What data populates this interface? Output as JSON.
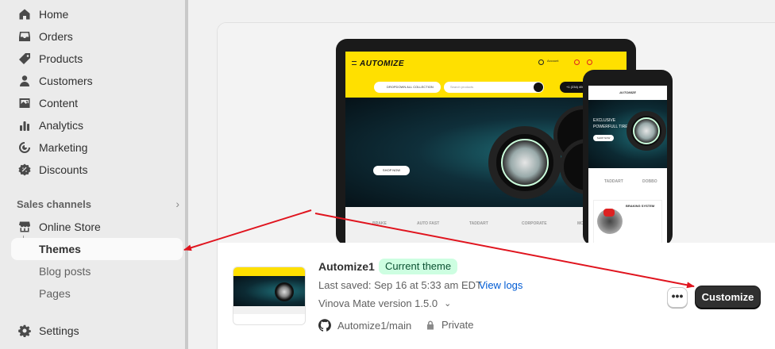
{
  "sidebar": {
    "items": [
      {
        "label": "Home",
        "icon": "home-icon"
      },
      {
        "label": "Orders",
        "icon": "inbox-icon"
      },
      {
        "label": "Products",
        "icon": "tag-icon"
      },
      {
        "label": "Customers",
        "icon": "person-icon"
      },
      {
        "label": "Content",
        "icon": "image-icon"
      },
      {
        "label": "Analytics",
        "icon": "bar-chart-icon"
      },
      {
        "label": "Marketing",
        "icon": "target-icon"
      },
      {
        "label": "Discounts",
        "icon": "discount-icon"
      }
    ],
    "sales_channels_label": "Sales channels",
    "online_store_label": "Online Store",
    "sub_items": [
      "Themes",
      "Blog posts",
      "Pages"
    ],
    "settings_label": "Settings"
  },
  "preview": {
    "laptop": {
      "logo": "AUTOMIZE",
      "account_text": "Account",
      "pill_collection": "DROPDOWN ALL COLLECTION",
      "search_placeholder": "Search products",
      "phone_text": "+1 (234) 456 0",
      "hero_button": "SHOP NOW",
      "brands": [
        "BRAKE",
        "AUTO FAST",
        "TADDART",
        "CORPORATE",
        "MOTO"
      ]
    },
    "phone": {
      "logo": "AUTOMIZE",
      "hero_line1": "EXCLUSIVE",
      "hero_line2": "POWERFULL TIRES",
      "hero_button": "SHOP NOW",
      "brands": [
        "TADDART",
        "DOBBO"
      ],
      "product_title": "BRAKING SYSTEM"
    }
  },
  "theme": {
    "name": "Automize1",
    "badge": "Current theme",
    "last_saved": "Last saved: Sep 16 at 5:33 am EDT",
    "view_logs": "View logs",
    "version": "Vinova Mate version 1.5.0",
    "repo": "Automize1/main",
    "visibility": "Private",
    "more_label": "•••",
    "customize_label": "Customize"
  },
  "colors": {
    "badge_bg": "#cdfee1",
    "link": "#005bd3",
    "primary_button": "#303030",
    "arrow": "#e0141e",
    "brand_yellow": "#ffe000"
  }
}
